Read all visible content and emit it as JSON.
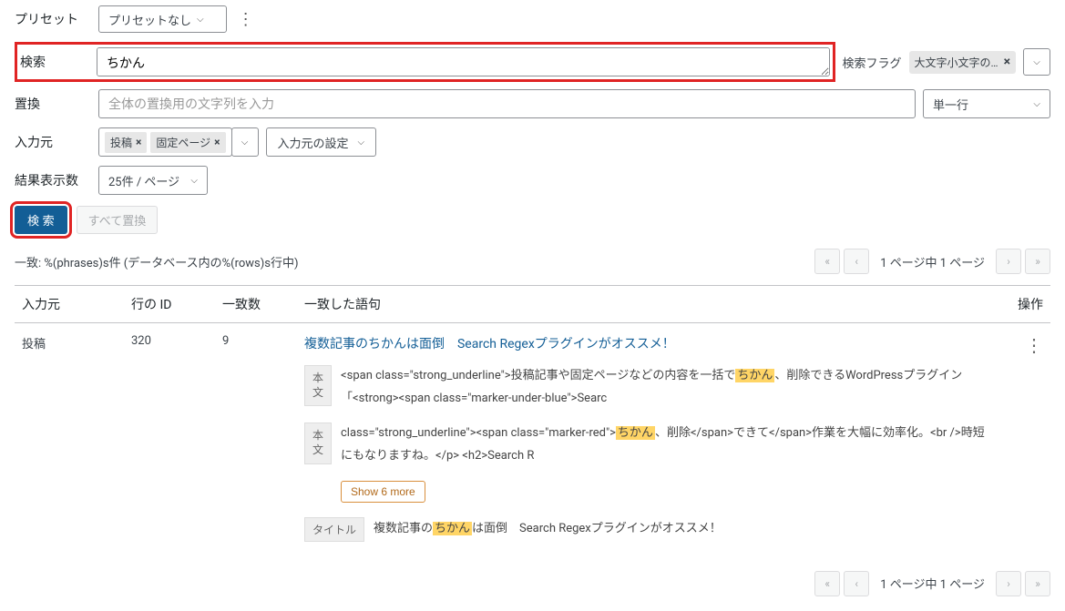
{
  "preset": {
    "label": "プリセット",
    "value": "プリセットなし"
  },
  "search": {
    "label": "検索",
    "value": "ちかん"
  },
  "flags": {
    "label": "検索フラグ",
    "chip": "大文字小文字の…"
  },
  "replace": {
    "label": "置換",
    "placeholder": "全体の置換用の文字列を入力",
    "mode": "単一行"
  },
  "source": {
    "label": "入力元",
    "chip1": "投稿",
    "chip2": "固定ページ",
    "settings": "入力元の設定"
  },
  "perpage": {
    "label": "結果表示数",
    "value": "25件 / ページ"
  },
  "buttons": {
    "search": "検 索",
    "replace_all": "すべて置換"
  },
  "matches_summary": "一致: %(phrases)s件 (データベース内の%(rows)s行中)",
  "pager": {
    "first": "«",
    "prev": "‹",
    "info": "1 ページ中 1 ページ",
    "next": "›",
    "last": "»"
  },
  "columns": {
    "src": "入力元",
    "id": "行の ID",
    "cnt": "一致数",
    "phrase": "一致した語句",
    "act": "操作"
  },
  "row": {
    "src": "投稿",
    "id": "320",
    "cnt": "9",
    "title_link": "複数記事のちかんは面倒　Search Regexプラグインがオススメ！",
    "match1": {
      "badge": "本文",
      "pre": "<span class=\"strong_underline\">投稿記事や固定ページなどの内容を一括で",
      "hl": "ちかん",
      "post": "、削除できるWordPressプラグイン「<strong><span class=\"marker-under-blue\">Searc"
    },
    "match2": {
      "badge": "本文",
      "pre": "class=\"strong_underline\"><span class=\"marker-red\">",
      "hl": "ちかん",
      "post": "、削除</span>できて</span>作業を大幅に効率化。<br />時短にもなりますね。</p> <h2>Search R"
    },
    "show_more": "Show 6 more",
    "title_match": {
      "badge": "タイトル",
      "pre": "複数記事の",
      "hl": "ちかん",
      "post": "は面倒　Search Regexプラグインがオススメ！"
    }
  }
}
